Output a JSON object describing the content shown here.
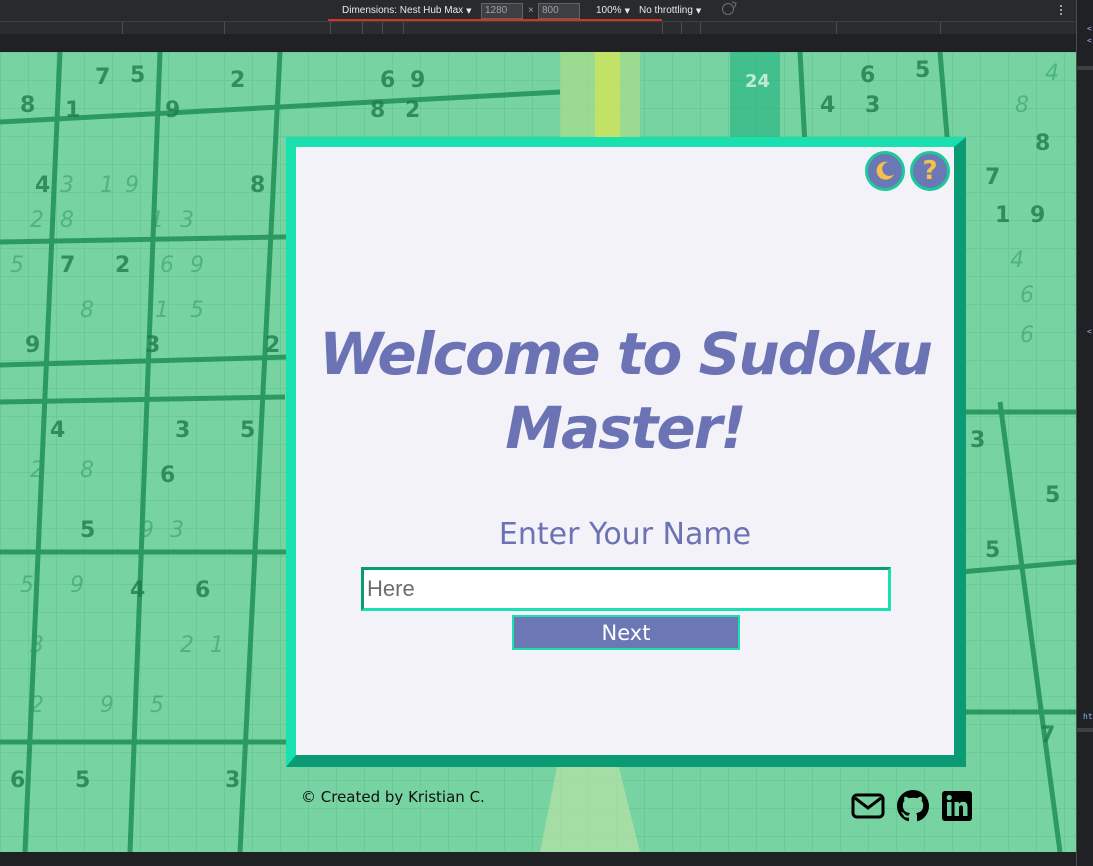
{
  "devtools": {
    "dimensions_label": "Dimensions: Nest Hub Max",
    "width_value": "1280",
    "times": "×",
    "height_value": "800",
    "zoom": "100%",
    "throttling": "No throttling",
    "side_marker": "htt"
  },
  "app": {
    "title": "Welcome to Sudoku Master!",
    "name_label": "Enter Your Name",
    "name_input": {
      "placeholder": "Here",
      "value": ""
    },
    "next_label": "Next",
    "footer_credit": "© Created by Kristian C.",
    "icons": {
      "theme_toggle": "moon-icon",
      "help": "question-mark-icon",
      "help_glyph": "?",
      "mail": "envelope-icon",
      "github": "github-icon",
      "linkedin": "linkedin-icon"
    },
    "colors": {
      "card_bg": "#f3f2f8",
      "accent_teal": "#1ae0b0",
      "accent_dark_teal": "#0b9b74",
      "purple": "#6c77b5",
      "gold": "#f3c14a",
      "background_green": "#6fcf9c"
    }
  }
}
